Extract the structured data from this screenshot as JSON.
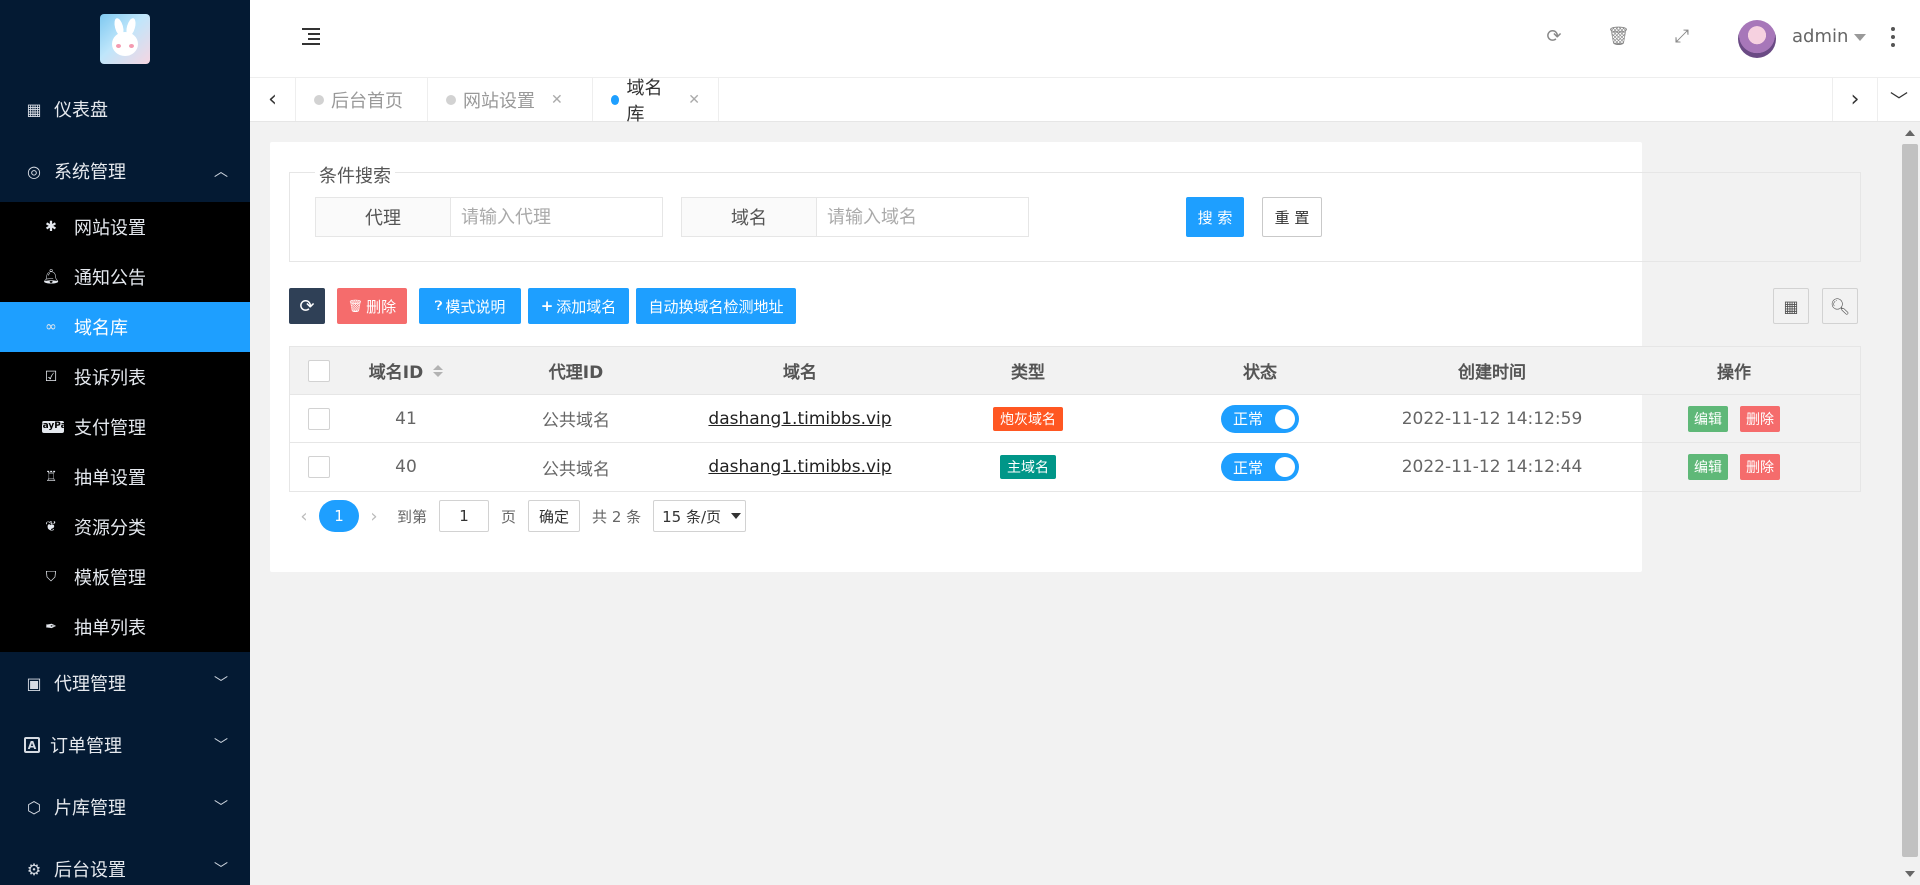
{
  "sidebar": {
    "dashboard": "仪表盘",
    "system": {
      "label": "系统管理",
      "items": [
        {
          "label": "网站设置",
          "icon": "asterisk-icon"
        },
        {
          "label": "通知公告",
          "icon": "bell-icon"
        },
        {
          "label": "域名库",
          "icon": "link-icon"
        },
        {
          "label": "投诉列表",
          "icon": "check-square-icon"
        },
        {
          "label": "支付管理",
          "icon": "paypal-icon"
        },
        {
          "label": "抽单设置",
          "icon": "castle-icon"
        },
        {
          "label": "资源分类",
          "icon": "leaf-icon"
        },
        {
          "label": "模板管理",
          "icon": "html5-icon"
        },
        {
          "label": "抽单列表",
          "icon": "quill-icon"
        }
      ]
    },
    "agent": "代理管理",
    "order": "订单管理",
    "library": "片库管理",
    "backend": "后台设置"
  },
  "header": {
    "user": "admin"
  },
  "tabs": [
    {
      "label": "后台首页",
      "closable": false
    },
    {
      "label": "网站设置",
      "closable": true
    },
    {
      "label": "域名库",
      "closable": true,
      "active": true
    }
  ],
  "search": {
    "legend": "条件搜索",
    "agent_label": "代理",
    "agent_placeholder": "请输入代理",
    "domain_label": "域名",
    "domain_placeholder": "请输入域名",
    "search_btn": "搜 索",
    "reset_btn": "重 置"
  },
  "toolbar": {
    "delete": "删除",
    "mode_help": "模式说明",
    "add_domain": "添加域名",
    "auto_switch": "自动换域名检测地址"
  },
  "table": {
    "headers": [
      "域名ID",
      "代理ID",
      "域名",
      "类型",
      "状态",
      "创建时间",
      "操作"
    ],
    "rows": [
      {
        "id": "41",
        "agent": "公共域名",
        "domain": "dashang1.timibbs.vip",
        "type": "炮灰域名",
        "status": "正常",
        "created": "2022-11-12 14:12:59"
      },
      {
        "id": "40",
        "agent": "公共域名",
        "domain": "dashang1.timibbs.vip",
        "type": "主域名",
        "status": "正常",
        "created": "2022-11-12 14:12:44"
      }
    ],
    "edit": "编辑",
    "delete": "删除"
  },
  "pager": {
    "current": "1",
    "goto": "到第",
    "page_value": "1",
    "page_unit": "页",
    "ok": "确定",
    "total": "共 2 条",
    "per_page": "15 条/页"
  }
}
